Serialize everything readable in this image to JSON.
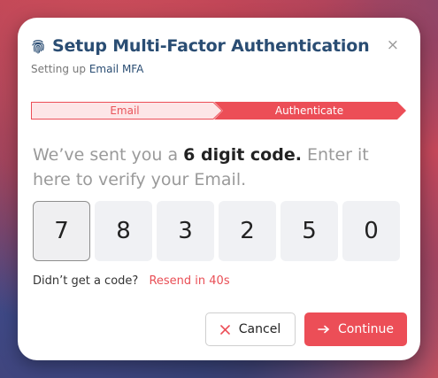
{
  "dialog": {
    "title": "Setup Multi-Factor Authentication",
    "subtitle_prefix": "Setting up",
    "subtitle_method": "Email MFA",
    "close_glyph": "×"
  },
  "steps": [
    {
      "label": "Email",
      "state": "completed"
    },
    {
      "label": "Authenticate",
      "state": "current"
    }
  ],
  "prompt": {
    "lead": "We’ve sent you a",
    "emphasis": "6 digit code.",
    "tail": "Enter it here to verify your Email."
  },
  "otp": {
    "digits": [
      "7",
      "8",
      "3",
      "2",
      "5",
      "0"
    ],
    "active_index": 0
  },
  "resend": {
    "question": "Didn’t get a code?",
    "link": "Resend in 40s"
  },
  "buttons": {
    "cancel": "Cancel",
    "continue": "Continue"
  },
  "colors": {
    "accent": "#ec4e57",
    "title": "#2a4d73",
    "step_completed_bg": "#fde6e7"
  },
  "icons": {
    "title": "fingerprint-icon",
    "close": "close-icon",
    "cancel": "x-icon",
    "continue": "arrow-right-icon"
  }
}
